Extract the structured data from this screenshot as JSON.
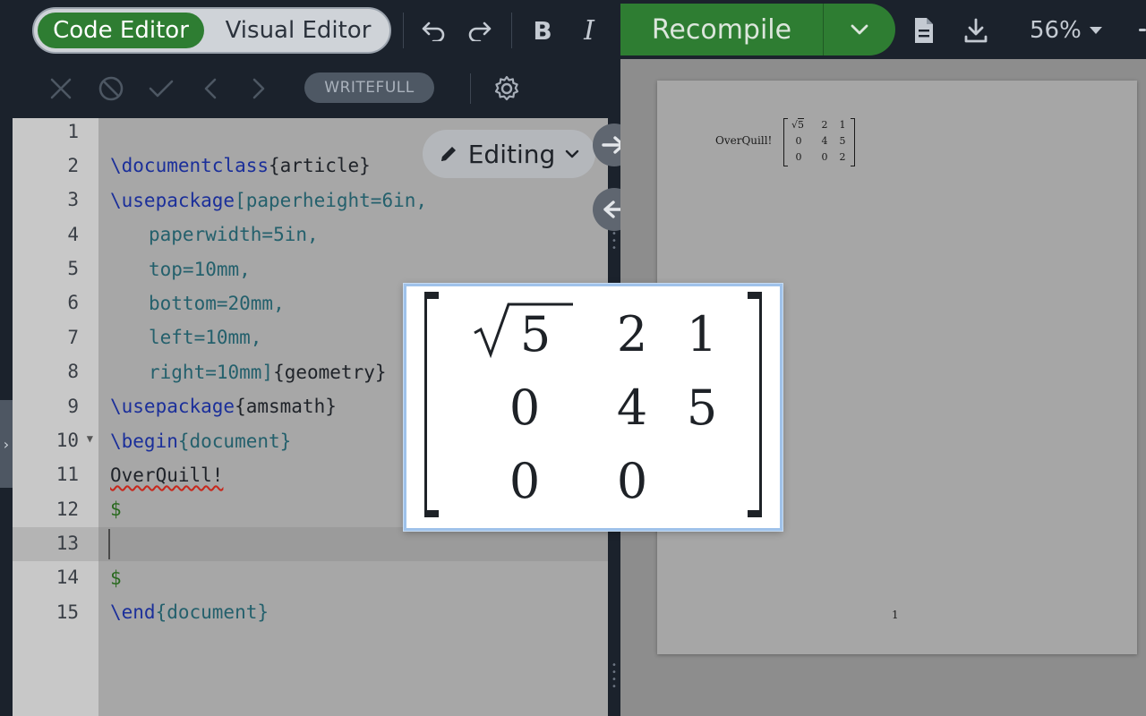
{
  "toolbar": {
    "code_editor": "Code Editor",
    "visual_editor": "Visual Editor",
    "bold": "B",
    "italic": "I",
    "recompile": "Recompile",
    "zoom": "56%"
  },
  "subtoolbar": {
    "writefull": "WRITEFULL"
  },
  "editor": {
    "editing_mode": "Editing",
    "lines": [
      {
        "num": "1"
      },
      {
        "num": "2"
      },
      {
        "num": "3"
      },
      {
        "num": "4"
      },
      {
        "num": "5"
      },
      {
        "num": "6"
      },
      {
        "num": "7"
      },
      {
        "num": "8"
      },
      {
        "num": "9"
      },
      {
        "num": "10"
      },
      {
        "num": "11"
      },
      {
        "num": "12"
      },
      {
        "num": "13"
      },
      {
        "num": "14"
      },
      {
        "num": "15"
      }
    ],
    "code": {
      "l2_cmd": "\\documentclass",
      "l2_arg": "{article}",
      "l3_cmd": "\\usepackage",
      "l3_opt": "[paperheight=6in,",
      "l4": "paperwidth=5in,",
      "l5": "top=10mm,",
      "l6": "bottom=20mm,",
      "l7": "left=10mm,",
      "l8_opt": "right=10mm]",
      "l8_arg": "{geometry}",
      "l9_cmd": "\\usepackage",
      "l9_arg": "{amsmath}",
      "l10_cmd": "\\begin",
      "l10_arg": "{document}",
      "l11": "OverQuill!",
      "l12": "$",
      "l14": "$",
      "l15_cmd": "\\end",
      "l15_arg": "{document}"
    }
  },
  "math_preview": {
    "cells": [
      "5",
      "2",
      "1",
      "0",
      "4",
      "5",
      "0",
      "0",
      ""
    ]
  },
  "pdf": {
    "text": "OverQuill!",
    "matrix": [
      "5",
      "2",
      "1",
      "0",
      "4",
      "5",
      "0",
      "0",
      "2"
    ],
    "page_number": "1"
  }
}
